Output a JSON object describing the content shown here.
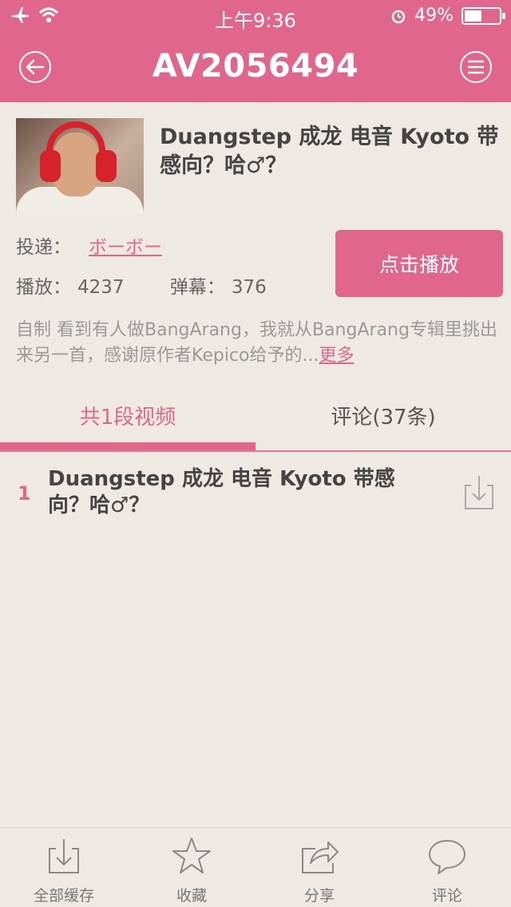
{
  "status_bar": {
    "time": "上午9:36",
    "battery": "49%",
    "battery_level": 0.49
  },
  "nav": {
    "title": "AV2056494",
    "back_icon": "circle-arrow-left-icon",
    "menu_icon": "circle-menu-icon"
  },
  "video": {
    "title": "Duangstep 成龙 电音 Kyoto 带感向？哈♂？",
    "uploader_label": "投递：",
    "uploader_name": "ボーボー",
    "plays_label": "播放：",
    "plays": "4237",
    "danmu_label": "弹幕：",
    "danmu": "376",
    "play_button": "点击播放",
    "description": "自制 看到有人做BangArang，我就从BangArang专辑里挑出来另一首，感谢原作者Kepico给予的...",
    "more": "更多"
  },
  "tabs": [
    {
      "label": "共1段视频",
      "active": true
    },
    {
      "label": "评论(37条)",
      "active": false
    }
  ],
  "episodes": [
    {
      "number": "1",
      "title": "Duangstep 成龙 电音 Kyoto 带感向？哈♂？"
    }
  ],
  "toolbar": [
    {
      "label": "全部缓存",
      "icon": "download-icon"
    },
    {
      "label": "收藏",
      "icon": "star-icon"
    },
    {
      "label": "分享",
      "icon": "share-icon"
    },
    {
      "label": "评论",
      "icon": "comment-icon"
    }
  ],
  "colors": {
    "accent": "#e0678b",
    "background": "#eeeae3"
  }
}
